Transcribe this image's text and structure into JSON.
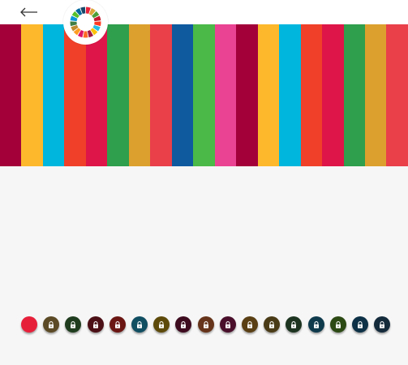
{
  "header": {
    "back_icon": "arrow-left-icon",
    "logo_icon": "sdg-wheel-icon"
  },
  "stripes": [
    "#a3003a",
    "#fdb92b",
    "#00b6dd",
    "#f04029",
    "#dd1548",
    "#2f9e4d",
    "#dca02e",
    "#e9404a",
    "#0f5a9f",
    "#4ab948",
    "#ea4393",
    "#a3003a",
    "#fdb92b",
    "#00b6dd",
    "#f04029",
    "#dd1548",
    "#2f9e4d",
    "#dca02e",
    "#e9404a"
  ],
  "wheel_colors": [
    "#e5243b",
    "#dda63a",
    "#4c9f38",
    "#c5192d",
    "#ff3a21",
    "#26bde2",
    "#fcc30b",
    "#a21942",
    "#fd6925",
    "#dd1367",
    "#fd9d24",
    "#bf8b2e",
    "#3f7e44",
    "#0a97d9",
    "#56c02b",
    "#00689d",
    "#19486a"
  ],
  "progress": {
    "active_color": "#e7203a",
    "items": [
      {
        "locked": false,
        "color": "#e7203a",
        "icon": "none"
      },
      {
        "locked": true,
        "color": "#5b4a25",
        "icon": "lock-icon"
      },
      {
        "locked": true,
        "color": "#1f3d1e",
        "icon": "lock-icon"
      },
      {
        "locked": true,
        "color": "#4b0f15",
        "icon": "lock-icon"
      },
      {
        "locked": true,
        "color": "#6b1613",
        "icon": "lock-icon"
      },
      {
        "locked": true,
        "color": "#104e62",
        "icon": "lock-icon"
      },
      {
        "locked": true,
        "color": "#5d4a0a",
        "icon": "lock-icon"
      },
      {
        "locked": true,
        "color": "#3d0a1e",
        "icon": "lock-icon"
      },
      {
        "locked": true,
        "color": "#66341a",
        "icon": "lock-icon"
      },
      {
        "locked": true,
        "color": "#4a0f2b",
        "icon": "lock-icon"
      },
      {
        "locked": true,
        "color": "#5a3f14",
        "icon": "lock-icon"
      },
      {
        "locked": true,
        "color": "#4a3b17",
        "icon": "lock-icon"
      },
      {
        "locked": true,
        "color": "#1c3420",
        "icon": "lock-icon"
      },
      {
        "locked": true,
        "color": "#0e3a4c",
        "icon": "lock-icon"
      },
      {
        "locked": true,
        "color": "#2c4a14",
        "icon": "lock-icon"
      },
      {
        "locked": true,
        "color": "#0d3146",
        "icon": "lock-icon"
      },
      {
        "locked": true,
        "color": "#142b3c",
        "icon": "lock-icon"
      }
    ]
  }
}
